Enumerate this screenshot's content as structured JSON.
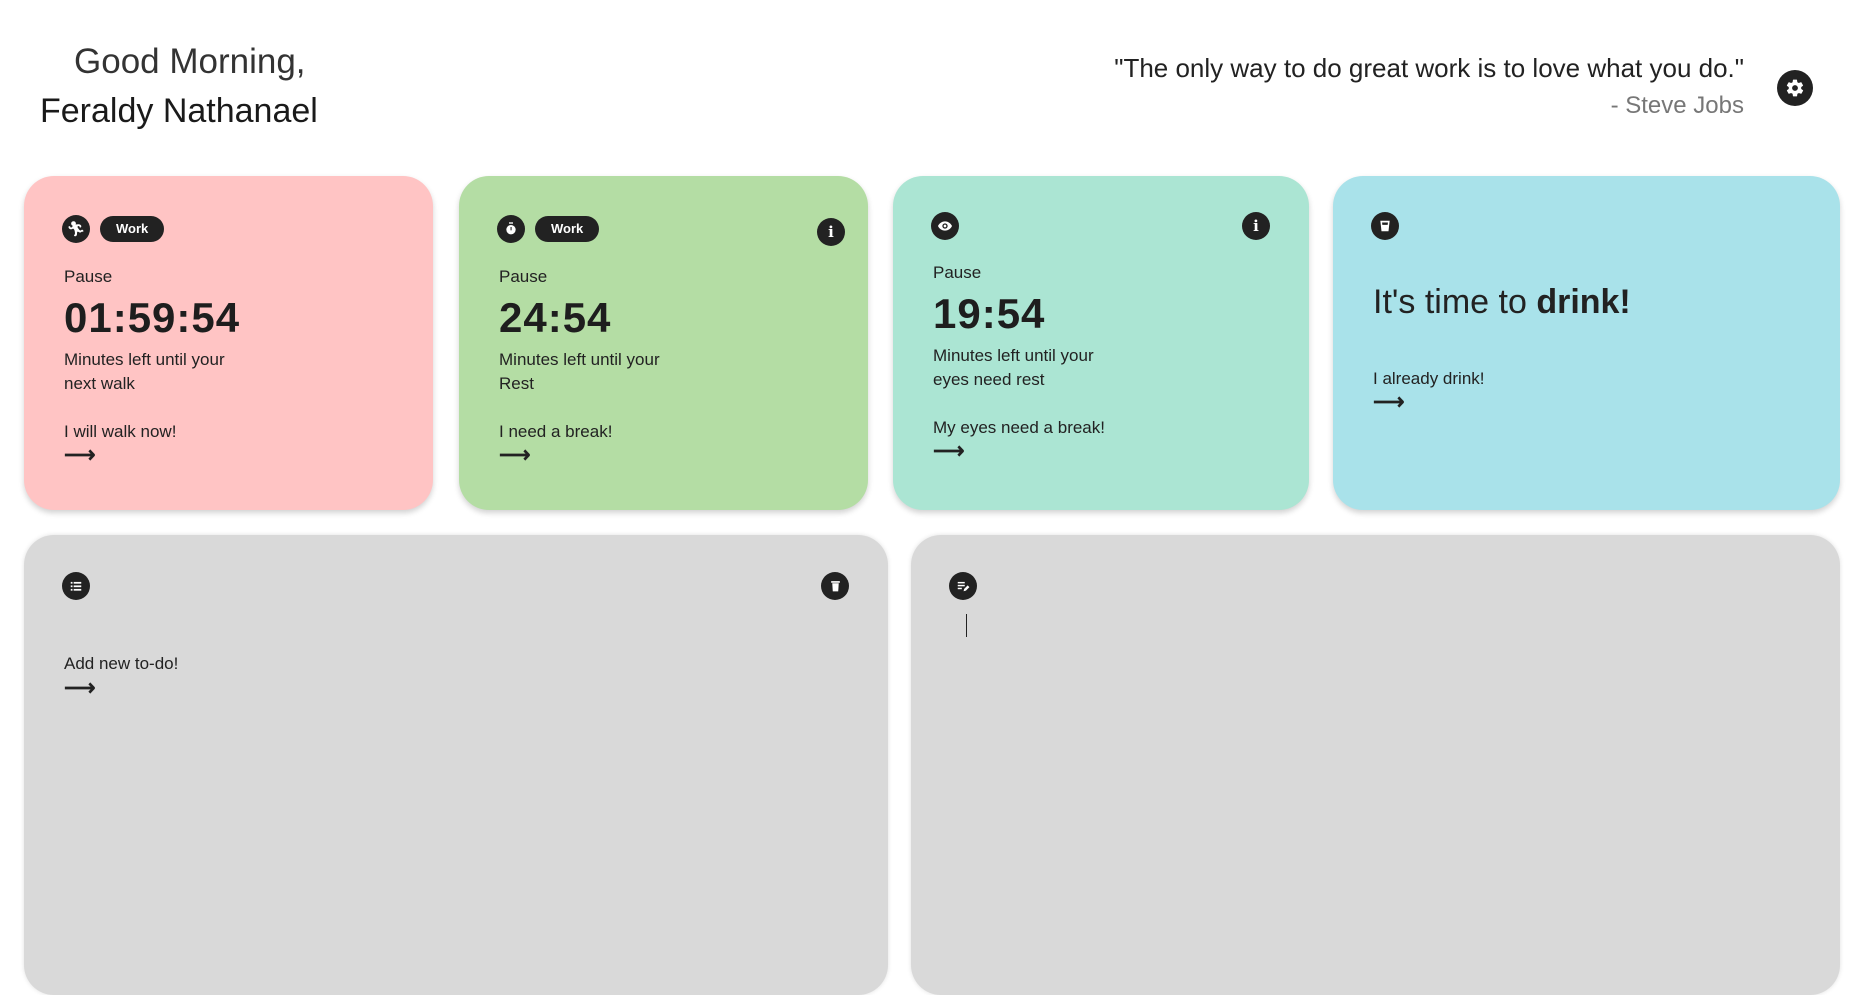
{
  "header": {
    "greeting": "Good Morning,",
    "user_name": "Feraldy Nathanael",
    "quote": "\"The only way to do great work is to love what you do.\"",
    "quote_author": "- Steve Jobs",
    "settings_icon": "gear-icon"
  },
  "cards": {
    "walk": {
      "color": "#ffc4c4",
      "icon": "running-icon",
      "badge": "Work",
      "status": "Pause",
      "timer": "01:59:54",
      "desc_line1": "Minutes left until your",
      "desc_line2": "next walk",
      "action": "I will walk now!"
    },
    "pomodoro": {
      "color": "#b4dda4",
      "icon": "stopwatch-icon",
      "badge": "Work",
      "status": "Pause",
      "timer": "24:54",
      "desc_line1": "Minutes left until your",
      "desc_line2": "Rest",
      "action": "I need a break!"
    },
    "eyes": {
      "color": "#abe5d3",
      "icon": "eye-icon",
      "status": "Pause",
      "timer": "19:54",
      "desc_line1": "Minutes left until your",
      "desc_line2": "eyes need rest",
      "action": "My eyes need a break!"
    },
    "drink": {
      "color": "#a9e2ea",
      "icon": "cup-icon",
      "message_prefix": "It's time to ",
      "message_bold": "drink!",
      "action": "I already drink!"
    }
  },
  "todo": {
    "icon": "list-icon",
    "clear_icon": "trash-icon",
    "action": "Add new to-do!"
  },
  "notes": {
    "icon": "edit-note-icon",
    "value": ""
  }
}
